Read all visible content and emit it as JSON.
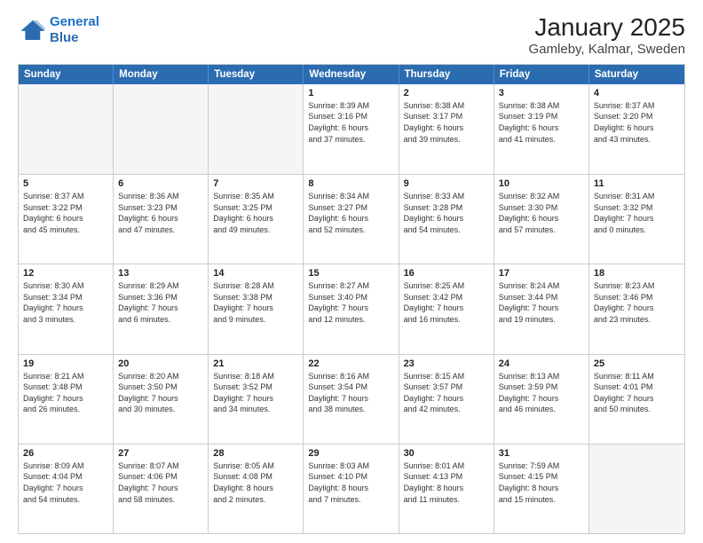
{
  "logo": {
    "line1": "General",
    "line2": "Blue"
  },
  "title": "January 2025",
  "subtitle": "Gamleby, Kalmar, Sweden",
  "weekdays": [
    "Sunday",
    "Monday",
    "Tuesday",
    "Wednesday",
    "Thursday",
    "Friday",
    "Saturday"
  ],
  "weeks": [
    [
      {
        "day": "",
        "text": "",
        "empty": true
      },
      {
        "day": "",
        "text": "",
        "empty": true
      },
      {
        "day": "",
        "text": "",
        "empty": true
      },
      {
        "day": "1",
        "text": "Sunrise: 8:39 AM\nSunset: 3:16 PM\nDaylight: 6 hours\nand 37 minutes."
      },
      {
        "day": "2",
        "text": "Sunrise: 8:38 AM\nSunset: 3:17 PM\nDaylight: 6 hours\nand 39 minutes."
      },
      {
        "day": "3",
        "text": "Sunrise: 8:38 AM\nSunset: 3:19 PM\nDaylight: 6 hours\nand 41 minutes."
      },
      {
        "day": "4",
        "text": "Sunrise: 8:37 AM\nSunset: 3:20 PM\nDaylight: 6 hours\nand 43 minutes."
      }
    ],
    [
      {
        "day": "5",
        "text": "Sunrise: 8:37 AM\nSunset: 3:22 PM\nDaylight: 6 hours\nand 45 minutes."
      },
      {
        "day": "6",
        "text": "Sunrise: 8:36 AM\nSunset: 3:23 PM\nDaylight: 6 hours\nand 47 minutes."
      },
      {
        "day": "7",
        "text": "Sunrise: 8:35 AM\nSunset: 3:25 PM\nDaylight: 6 hours\nand 49 minutes."
      },
      {
        "day": "8",
        "text": "Sunrise: 8:34 AM\nSunset: 3:27 PM\nDaylight: 6 hours\nand 52 minutes."
      },
      {
        "day": "9",
        "text": "Sunrise: 8:33 AM\nSunset: 3:28 PM\nDaylight: 6 hours\nand 54 minutes."
      },
      {
        "day": "10",
        "text": "Sunrise: 8:32 AM\nSunset: 3:30 PM\nDaylight: 6 hours\nand 57 minutes."
      },
      {
        "day": "11",
        "text": "Sunrise: 8:31 AM\nSunset: 3:32 PM\nDaylight: 7 hours\nand 0 minutes."
      }
    ],
    [
      {
        "day": "12",
        "text": "Sunrise: 8:30 AM\nSunset: 3:34 PM\nDaylight: 7 hours\nand 3 minutes."
      },
      {
        "day": "13",
        "text": "Sunrise: 8:29 AM\nSunset: 3:36 PM\nDaylight: 7 hours\nand 6 minutes."
      },
      {
        "day": "14",
        "text": "Sunrise: 8:28 AM\nSunset: 3:38 PM\nDaylight: 7 hours\nand 9 minutes."
      },
      {
        "day": "15",
        "text": "Sunrise: 8:27 AM\nSunset: 3:40 PM\nDaylight: 7 hours\nand 12 minutes."
      },
      {
        "day": "16",
        "text": "Sunrise: 8:25 AM\nSunset: 3:42 PM\nDaylight: 7 hours\nand 16 minutes."
      },
      {
        "day": "17",
        "text": "Sunrise: 8:24 AM\nSunset: 3:44 PM\nDaylight: 7 hours\nand 19 minutes."
      },
      {
        "day": "18",
        "text": "Sunrise: 8:23 AM\nSunset: 3:46 PM\nDaylight: 7 hours\nand 23 minutes."
      }
    ],
    [
      {
        "day": "19",
        "text": "Sunrise: 8:21 AM\nSunset: 3:48 PM\nDaylight: 7 hours\nand 26 minutes."
      },
      {
        "day": "20",
        "text": "Sunrise: 8:20 AM\nSunset: 3:50 PM\nDaylight: 7 hours\nand 30 minutes."
      },
      {
        "day": "21",
        "text": "Sunrise: 8:18 AM\nSunset: 3:52 PM\nDaylight: 7 hours\nand 34 minutes."
      },
      {
        "day": "22",
        "text": "Sunrise: 8:16 AM\nSunset: 3:54 PM\nDaylight: 7 hours\nand 38 minutes."
      },
      {
        "day": "23",
        "text": "Sunrise: 8:15 AM\nSunset: 3:57 PM\nDaylight: 7 hours\nand 42 minutes."
      },
      {
        "day": "24",
        "text": "Sunrise: 8:13 AM\nSunset: 3:59 PM\nDaylight: 7 hours\nand 46 minutes."
      },
      {
        "day": "25",
        "text": "Sunrise: 8:11 AM\nSunset: 4:01 PM\nDaylight: 7 hours\nand 50 minutes."
      }
    ],
    [
      {
        "day": "26",
        "text": "Sunrise: 8:09 AM\nSunset: 4:04 PM\nDaylight: 7 hours\nand 54 minutes."
      },
      {
        "day": "27",
        "text": "Sunrise: 8:07 AM\nSunset: 4:06 PM\nDaylight: 7 hours\nand 58 minutes."
      },
      {
        "day": "28",
        "text": "Sunrise: 8:05 AM\nSunset: 4:08 PM\nDaylight: 8 hours\nand 2 minutes."
      },
      {
        "day": "29",
        "text": "Sunrise: 8:03 AM\nSunset: 4:10 PM\nDaylight: 8 hours\nand 7 minutes."
      },
      {
        "day": "30",
        "text": "Sunrise: 8:01 AM\nSunset: 4:13 PM\nDaylight: 8 hours\nand 11 minutes."
      },
      {
        "day": "31",
        "text": "Sunrise: 7:59 AM\nSunset: 4:15 PM\nDaylight: 8 hours\nand 15 minutes."
      },
      {
        "day": "",
        "text": "",
        "empty": true
      }
    ]
  ]
}
